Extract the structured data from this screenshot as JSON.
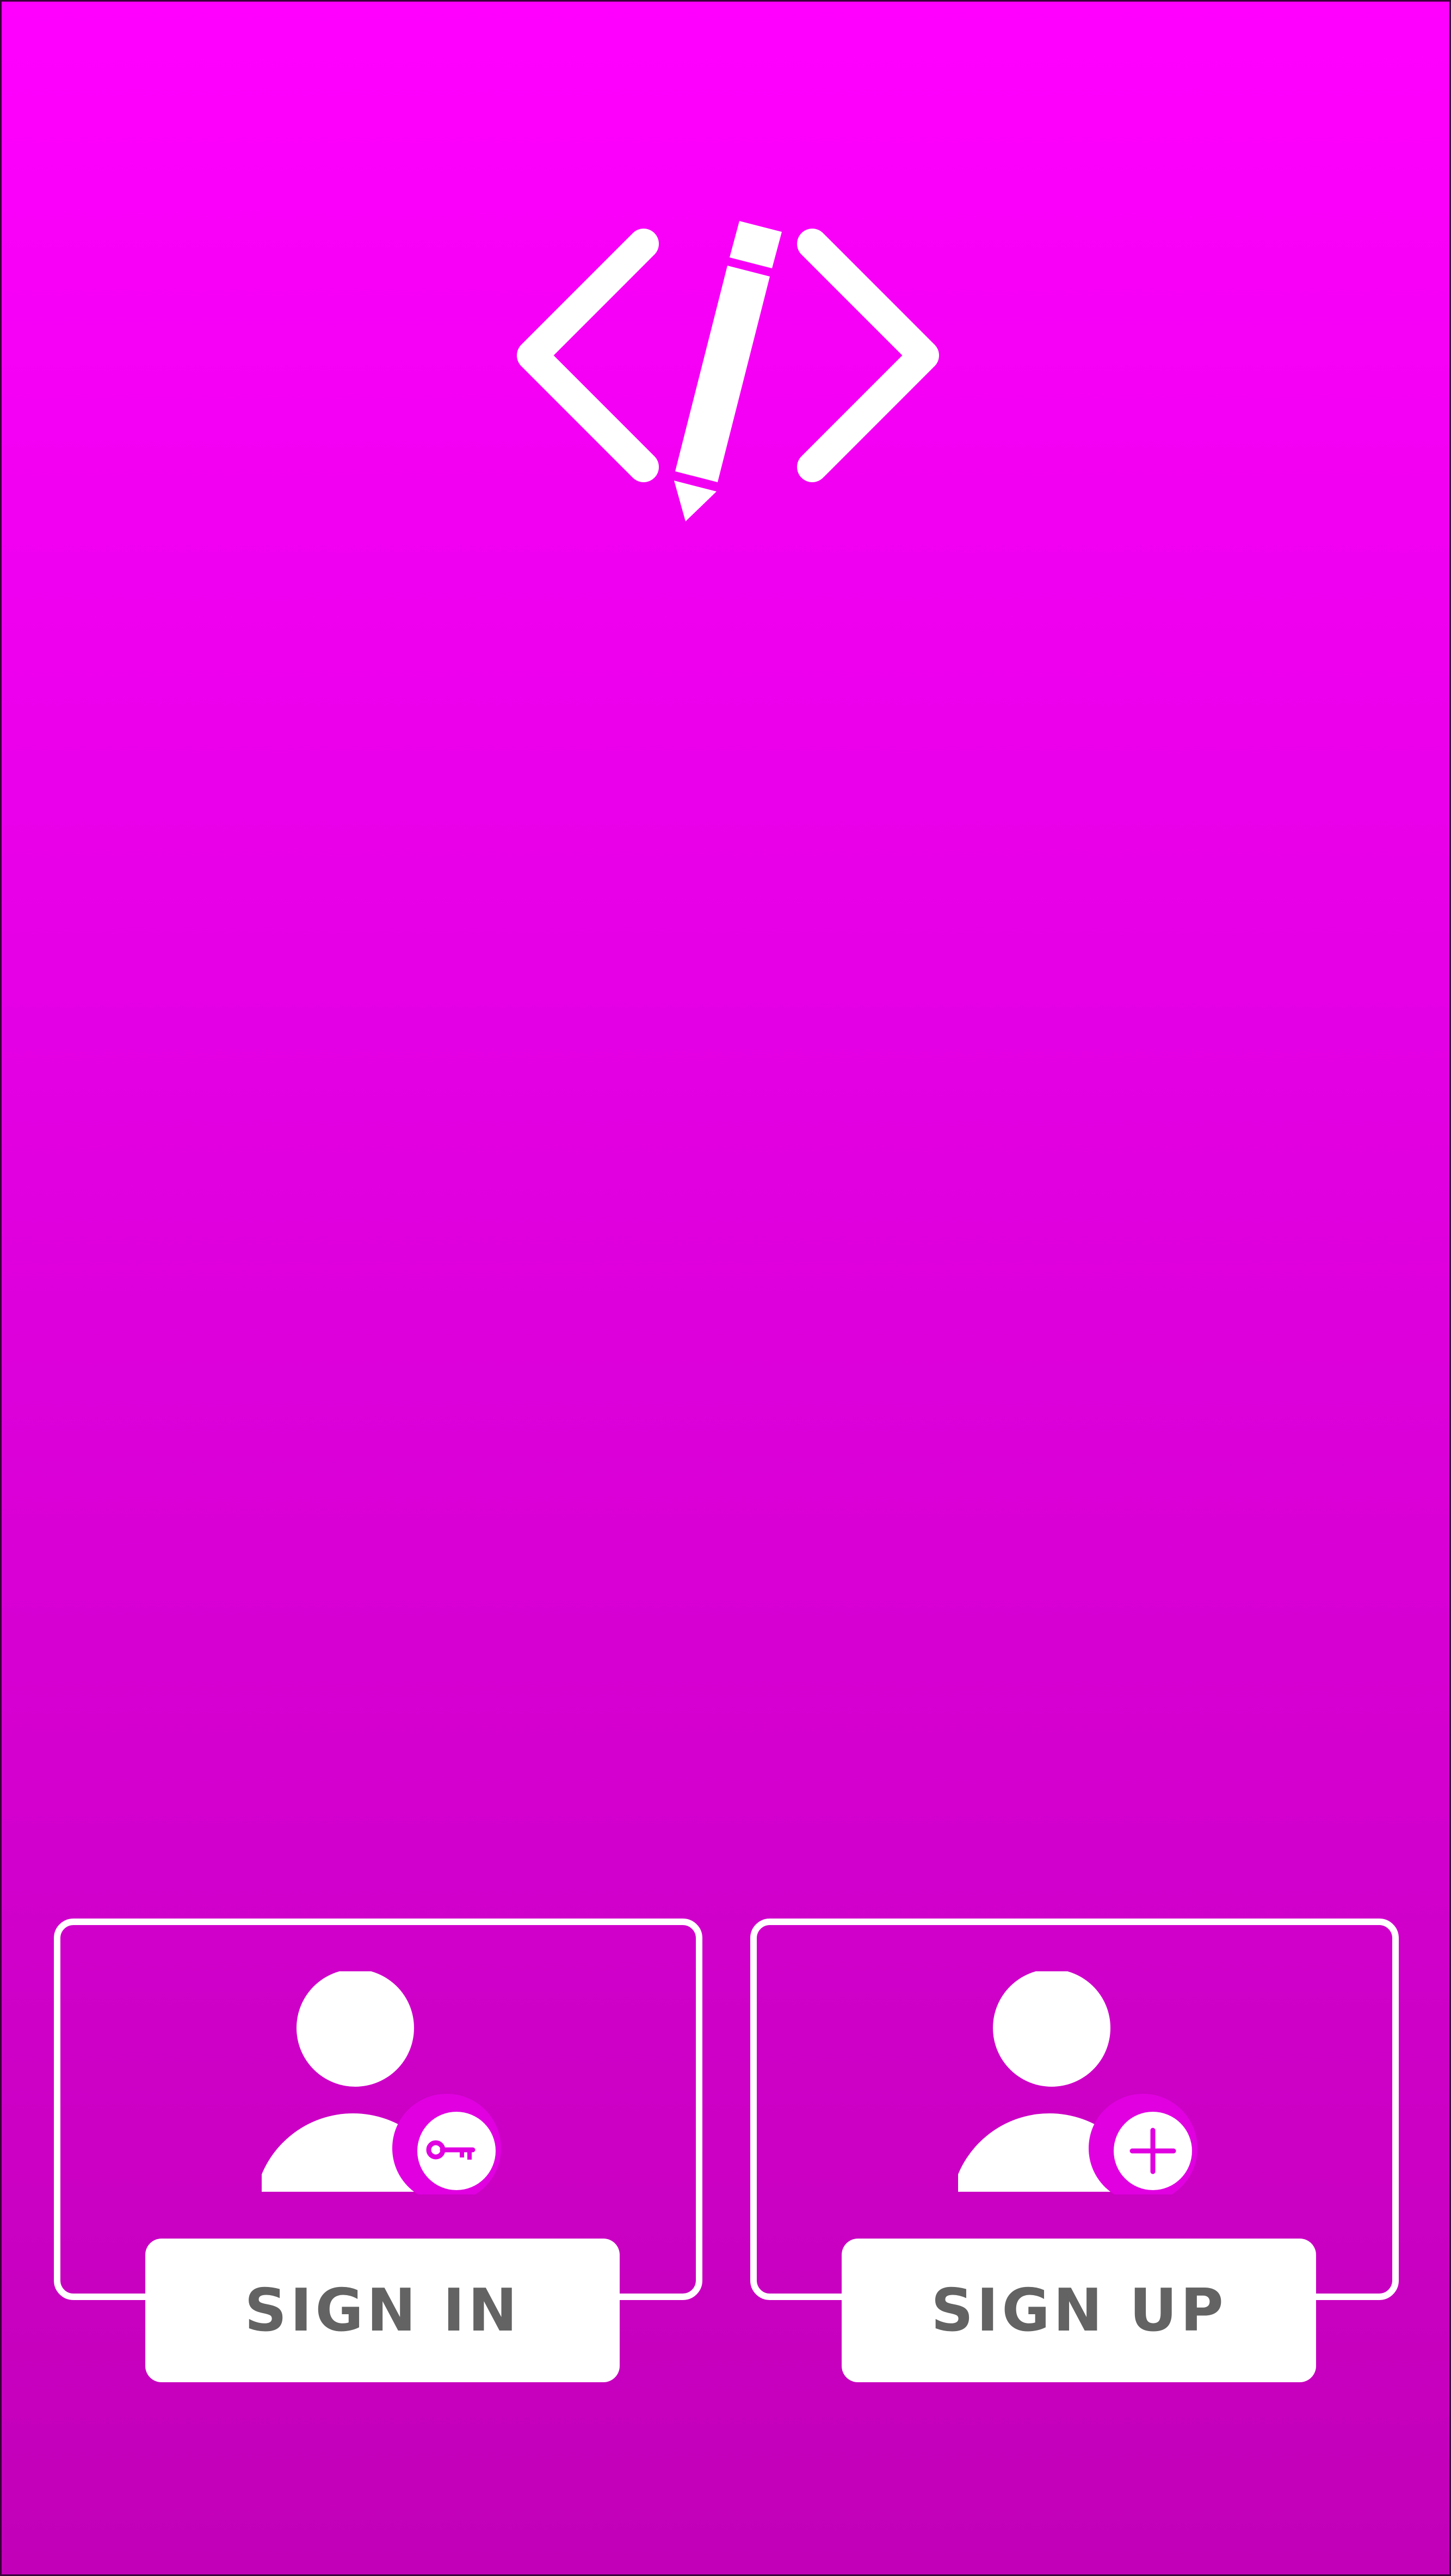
{
  "colors": {
    "background_top": "#ff00ff",
    "background_bottom": "#c200b8",
    "foreground": "#ffffff",
    "button_text": "#636363",
    "icon_accent": "#e000e0"
  },
  "logo": {
    "icon": "code-edit-icon"
  },
  "signin": {
    "icon": "user-key-icon",
    "label": "SIGN IN"
  },
  "signup": {
    "icon": "user-add-icon",
    "label": "SIGN UP"
  }
}
